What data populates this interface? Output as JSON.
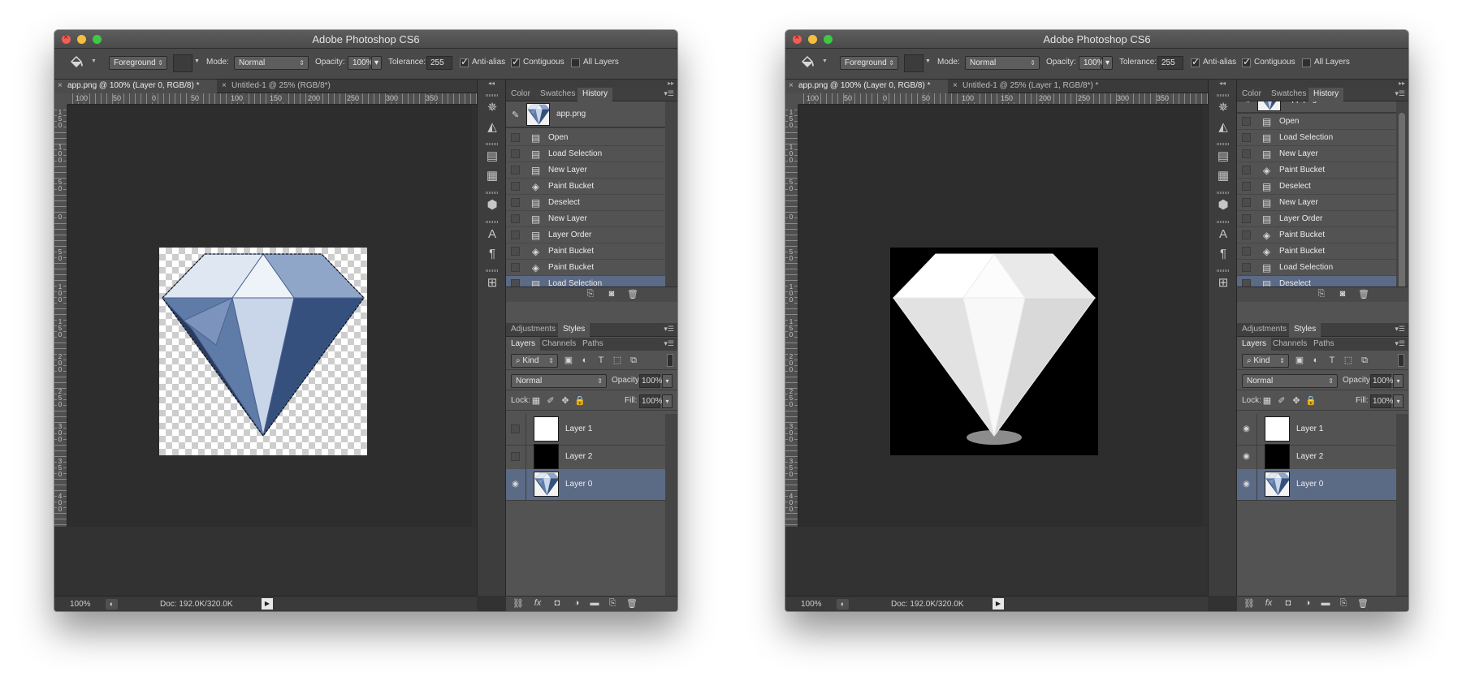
{
  "windows": [
    {
      "id": "left",
      "title": "Adobe Photoshop CS6",
      "options": {
        "preset": "Foreground",
        "mode_label": "Mode:",
        "mode_value": "Normal",
        "opacity_label": "Opacity:",
        "opacity_value": "100%",
        "tolerance_label": "Tolerance:",
        "tolerance_value": "255",
        "antialias_label": "Anti-alias",
        "antialias_checked": true,
        "contiguous_label": "Contiguous",
        "contiguous_checked": true,
        "all_layers_label": "All Layers",
        "all_layers_checked": false
      },
      "doc_tabs": [
        {
          "label": "app.png @ 100% (Layer 0, RGB/8) *",
          "active": true
        },
        {
          "label": "Untitled-1 @ 25% (RGB/8*)",
          "active": false
        }
      ],
      "ruler_top": [
        "100",
        "50",
        "0",
        "50",
        "100",
        "150",
        "200",
        "250",
        "300",
        "350"
      ],
      "ruler_left": [
        {
          "label": "1 5 0"
        },
        {
          "label": "1 0 0"
        },
        {
          "label": "5 0"
        },
        {
          "label": "0"
        },
        {
          "label": "5 0"
        },
        {
          "label": "1 0 0"
        },
        {
          "label": "1 5 0"
        },
        {
          "label": "2 0 0"
        },
        {
          "label": "2 5 0"
        },
        {
          "label": "3 0 0"
        },
        {
          "label": "3 5 0"
        },
        {
          "label": "4 0 0"
        }
      ],
      "canvas_style": "transparent-selected",
      "status": {
        "zoom": "100%",
        "doc_info": "Doc: 192.0K/320.0K"
      },
      "panel_tabs_top": [
        {
          "label": "Color",
          "active": false
        },
        {
          "label": "Swatches",
          "active": false
        },
        {
          "label": "History",
          "active": true
        }
      ],
      "history_snapshot": {
        "name": "app.png",
        "visible": true
      },
      "history_items": [
        {
          "label": "Open",
          "icon": "document-icon",
          "active": false
        },
        {
          "label": "Load Selection",
          "icon": "document-icon",
          "active": false
        },
        {
          "label": "New Layer",
          "icon": "document-icon",
          "active": false
        },
        {
          "label": "Paint Bucket",
          "icon": "paint-bucket-icon",
          "active": false
        },
        {
          "label": "Deselect",
          "icon": "document-icon",
          "active": false
        },
        {
          "label": "New Layer",
          "icon": "document-icon",
          "active": false
        },
        {
          "label": "Layer Order",
          "icon": "document-icon",
          "active": false
        },
        {
          "label": "Paint Bucket",
          "icon": "paint-bucket-icon",
          "active": false
        },
        {
          "label": "Paint Bucket",
          "icon": "paint-bucket-icon",
          "active": false
        },
        {
          "label": "Load Selection",
          "icon": "document-icon",
          "active": true
        }
      ],
      "history_scrollbar": false,
      "panel_tabs_mid": [
        {
          "label": "Adjustments",
          "active": false
        },
        {
          "label": "Styles",
          "active": true
        }
      ],
      "panel_tabs_layers": [
        {
          "label": "Layers",
          "active": true
        },
        {
          "label": "Channels",
          "active": false
        },
        {
          "label": "Paths",
          "active": false
        }
      ],
      "layers_filter": "Kind",
      "layers_blend": "Normal",
      "layers_opacity_label": "Opacity:",
      "layers_opacity_value": "100%",
      "lock_label": "Lock:",
      "fill_label": "Fill:",
      "fill_value": "100%",
      "layers": [
        {
          "name": "Layer 1",
          "visible": false,
          "thumb": "white",
          "active": false
        },
        {
          "name": "Layer 2",
          "visible": false,
          "thumb": "black",
          "active": false
        },
        {
          "name": "Layer 0",
          "visible": true,
          "thumb": "diamond",
          "active": true
        }
      ]
    },
    {
      "id": "right",
      "title": "Adobe Photoshop CS6",
      "options": {
        "preset": "Foreground",
        "mode_label": "Mode:",
        "mode_value": "Normal",
        "opacity_label": "Opacity:",
        "opacity_value": "100%",
        "tolerance_label": "Tolerance:",
        "tolerance_value": "255",
        "antialias_label": "Anti-alias",
        "antialias_checked": true,
        "contiguous_label": "Contiguous",
        "contiguous_checked": true,
        "all_layers_label": "All Layers",
        "all_layers_checked": false
      },
      "doc_tabs": [
        {
          "label": "app.png @ 100% (Layer 0, RGB/8) *",
          "active": true
        },
        {
          "label": "Untitled-1 @ 25% (Layer 1, RGB/8*) *",
          "active": false
        }
      ],
      "ruler_top": [
        "100",
        "50",
        "0",
        "50",
        "100",
        "150",
        "200",
        "250",
        "300",
        "350"
      ],
      "ruler_left": [
        {
          "label": "1 5 0"
        },
        {
          "label": "1 0 0"
        },
        {
          "label": "5 0"
        },
        {
          "label": "0"
        },
        {
          "label": "5 0"
        },
        {
          "label": "1 0 0"
        },
        {
          "label": "1 5 0"
        },
        {
          "label": "2 0 0"
        },
        {
          "label": "2 5 0"
        },
        {
          "label": "3 0 0"
        },
        {
          "label": "3 5 0"
        },
        {
          "label": "4 0 0"
        }
      ],
      "canvas_style": "black-white",
      "status": {
        "zoom": "100%",
        "doc_info": "Doc: 192.0K/320.0K"
      },
      "panel_tabs_top": [
        {
          "label": "Color",
          "active": false
        },
        {
          "label": "Swatches",
          "active": false
        },
        {
          "label": "History",
          "active": true
        }
      ],
      "history_snapshot": {
        "name": "app.png",
        "visible": false
      },
      "history_items": [
        {
          "label": "Open",
          "icon": "document-icon",
          "active": false
        },
        {
          "label": "Load Selection",
          "icon": "document-icon",
          "active": false
        },
        {
          "label": "New Layer",
          "icon": "document-icon",
          "active": false
        },
        {
          "label": "Paint Bucket",
          "icon": "paint-bucket-icon",
          "active": false
        },
        {
          "label": "Deselect",
          "icon": "document-icon",
          "active": false
        },
        {
          "label": "New Layer",
          "icon": "document-icon",
          "active": false
        },
        {
          "label": "Layer Order",
          "icon": "document-icon",
          "active": false
        },
        {
          "label": "Paint Bucket",
          "icon": "paint-bucket-icon",
          "active": false
        },
        {
          "label": "Paint Bucket",
          "icon": "paint-bucket-icon",
          "active": false
        },
        {
          "label": "Load Selection",
          "icon": "document-icon",
          "active": false
        },
        {
          "label": "Deselect",
          "icon": "document-icon",
          "active": true
        }
      ],
      "history_scrollbar": true,
      "panel_tabs_mid": [
        {
          "label": "Adjustments",
          "active": false
        },
        {
          "label": "Styles",
          "active": true
        }
      ],
      "panel_tabs_layers": [
        {
          "label": "Layers",
          "active": true
        },
        {
          "label": "Channels",
          "active": false
        },
        {
          "label": "Paths",
          "active": false
        }
      ],
      "layers_filter": "Kind",
      "layers_blend": "Normal",
      "layers_opacity_label": "Opacity:",
      "layers_opacity_value": "100%",
      "lock_label": "Lock:",
      "fill_label": "Fill:",
      "fill_value": "100%",
      "layers": [
        {
          "name": "Layer 1",
          "visible": true,
          "thumb": "white",
          "active": false
        },
        {
          "name": "Layer 2",
          "visible": true,
          "thumb": "black",
          "active": false
        },
        {
          "name": "Layer 0",
          "visible": true,
          "thumb": "diamond",
          "active": true
        }
      ]
    }
  ],
  "colors": {
    "panel": "#535353",
    "selected_row": "#5b6a85",
    "canvas_bg": "#2d2d2d",
    "traffic_close": "#f25d56",
    "traffic_min": "#f6be3c",
    "traffic_max": "#3ec944"
  }
}
